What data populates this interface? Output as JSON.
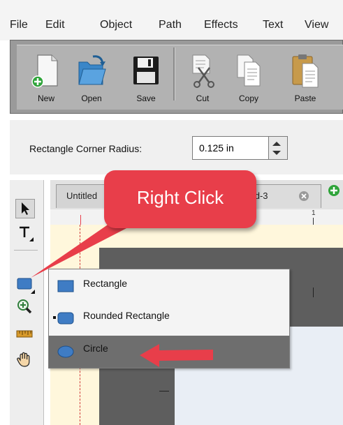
{
  "menubar": {
    "items": [
      "File",
      "Edit",
      "Object",
      "Path",
      "Effects",
      "Text",
      "View"
    ]
  },
  "toolbar": {
    "tools": [
      {
        "label": "New",
        "icon": "new-doc-icon"
      },
      {
        "label": "Open",
        "icon": "open-folder-icon"
      },
      {
        "label": "Save",
        "icon": "floppy-disk-icon"
      },
      {
        "label": "Cut",
        "icon": "scissors-icon"
      },
      {
        "label": "Copy",
        "icon": "copy-icon"
      },
      {
        "label": "Paste",
        "icon": "paste-icon"
      }
    ]
  },
  "property_bar": {
    "label": "Rectangle Corner Radius:",
    "value": "0.125 in"
  },
  "document_tabs": {
    "items": [
      "Untitled",
      "tled-3"
    ]
  },
  "ruler": {
    "tick": "1"
  },
  "context_menu": {
    "items": [
      {
        "label": "Rectangle",
        "icon": "rectangle-shape-icon",
        "highlighted": false
      },
      {
        "label": "Rounded Rectangle",
        "icon": "rounded-rectangle-shape-icon",
        "highlighted": false
      },
      {
        "label": "Circle",
        "icon": "circle-shape-icon",
        "highlighted": true
      }
    ]
  },
  "callout": {
    "text": "Right Click"
  },
  "colors": {
    "callout": "#e83e4a",
    "menu_highlight": "#6e6e6e",
    "toolbar": "#b2b2b2",
    "canvas_dark": "#5e5e5e",
    "shape_fill": "#3f7cc4"
  }
}
